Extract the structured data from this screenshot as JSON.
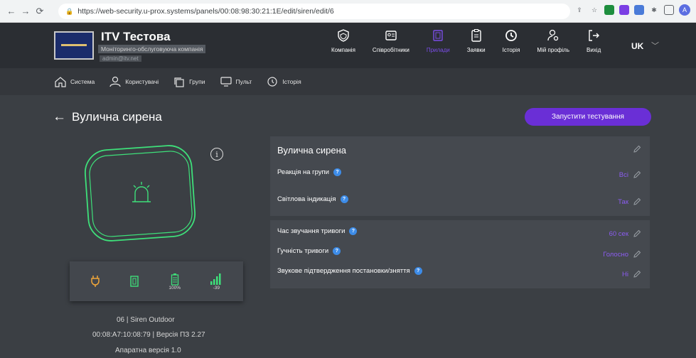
{
  "browser": {
    "url": "https://web-security.u-prox.systems/panels/00:08:98:30:21:1E/edit/siren/edit/6",
    "avatar_letter": "A"
  },
  "header": {
    "company_name": "ITV Тестова",
    "company_subtitle": "Моніторинго-обслуговуюча компанія",
    "company_email": "admin@itv.net",
    "nav": [
      {
        "label": "Компанія",
        "icon": "shield-icon"
      },
      {
        "label": "Співробітники",
        "icon": "id-card-icon"
      },
      {
        "label": "Прилади",
        "icon": "device-icon",
        "active": true
      },
      {
        "label": "Заявки",
        "icon": "clipboard-icon"
      },
      {
        "label": "Історія",
        "icon": "history-icon"
      },
      {
        "label": "Мій профіль",
        "icon": "profile-gear-icon"
      },
      {
        "label": "Вихід",
        "icon": "logout-icon"
      }
    ],
    "language": "UK"
  },
  "subnav": [
    {
      "label": "Система",
      "icon": "home-icon"
    },
    {
      "label": "Користувачі",
      "icon": "user-icon"
    },
    {
      "label": "Групи",
      "icon": "groups-icon"
    },
    {
      "label": "Пульт",
      "icon": "monitor-icon"
    },
    {
      "label": "Історія",
      "icon": "history-icon"
    }
  ],
  "page": {
    "title": "Вулична сирена",
    "test_button": "Запустити тестування"
  },
  "device": {
    "battery": "100%",
    "signal": "-39",
    "model": "06 | Siren Outdoor",
    "mac_fw": "00:08:A7:10:08:79 | Версія ПЗ 2.27",
    "hw": "Апаратна версія 1.0"
  },
  "settings": {
    "title": "Вулична сирена",
    "rows1": [
      {
        "label": "Реакція на групи",
        "value": "Всі"
      },
      {
        "label": "Світлова індикація",
        "value": "Так"
      }
    ],
    "rows2": [
      {
        "label": "Час звучання тривоги",
        "value": "60 сек"
      },
      {
        "label": "Гучність тривоги",
        "value": "Голосно"
      },
      {
        "label": "Звукове підтвердження постановки/зняття",
        "value": "Ні"
      }
    ]
  },
  "colors": {
    "accent": "#7a4de6",
    "button": "#6a2fd6",
    "device_outline": "#3ee07a",
    "status_icon": "#f0a63a",
    "signal": "#3ee07a",
    "help": "#3d8ce8"
  }
}
